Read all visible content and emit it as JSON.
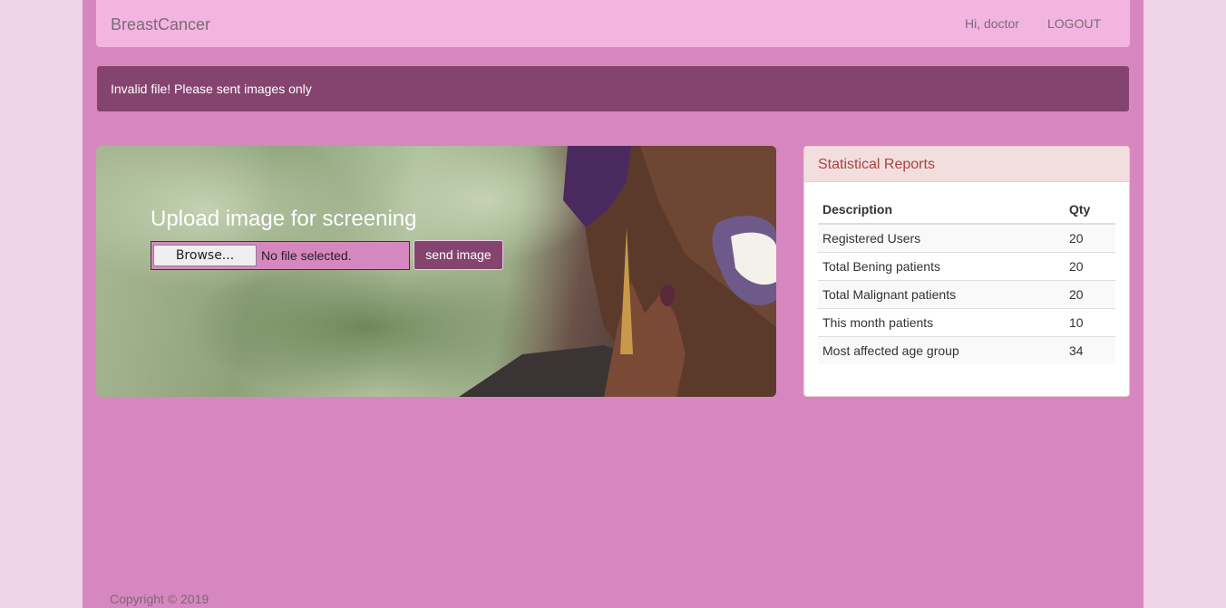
{
  "navbar": {
    "brand": "BreastCancer",
    "greeting": "Hi, doctor",
    "logout_label": "LOGOUT"
  },
  "alert": {
    "message": "Invalid file! Please sent images only"
  },
  "upload": {
    "title": "Upload image for screening",
    "browse_label": "Browse...",
    "file_status": "No file selected.",
    "send_label": "send image"
  },
  "stats_panel": {
    "title": "Statistical Reports",
    "columns": [
      "Description",
      "Qty"
    ],
    "rows": [
      {
        "description": "Registered Users",
        "qty": "20"
      },
      {
        "description": "Total Bening patients",
        "qty": "20"
      },
      {
        "description": "Total Malignant patients",
        "qty": "20"
      },
      {
        "description": "This month patients",
        "qty": "10"
      },
      {
        "description": "Most affected age group",
        "qty": "34"
      }
    ]
  },
  "footer": {
    "copyright": "Copyright © 2019"
  },
  "colors": {
    "page_background": "#d787c0",
    "navbar": "#f2b5e1",
    "alert": "#854470",
    "button": "#854470",
    "panel_heading": "#f2dede",
    "panel_title": "#a94442"
  }
}
